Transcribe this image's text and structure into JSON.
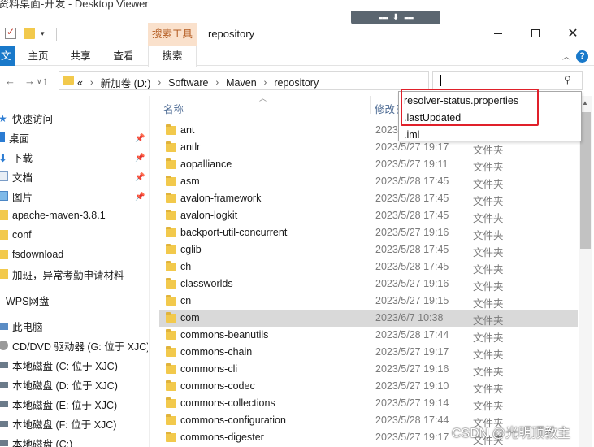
{
  "window": {
    "behind_title": "资料桌面-开发 - Desktop Viewer",
    "title": "repository",
    "context_tab": "搜索工具"
  },
  "remote_bar": {
    "dots_left": "▪▪▪▪▪",
    "arrow": "⬇",
    "dots_right": "▪▪▪▪▪"
  },
  "ribbon": {
    "file": "文件",
    "tabs": [
      "主页",
      "共享",
      "查看"
    ],
    "search_tab": "搜索",
    "help": "?"
  },
  "address": {
    "overflow": "«",
    "crumbs": [
      "新加卷 (D:)",
      "Software",
      "Maven",
      "repository"
    ]
  },
  "search": {
    "value": ""
  },
  "autocomplete": [
    "resolver-status.properties",
    ".lastUpdated",
    ".iml"
  ],
  "sidebar": {
    "quick_access": "快速访问",
    "items": [
      {
        "label": "桌面",
        "icon": "desktop-icon",
        "pinned": true
      },
      {
        "label": "下载",
        "icon": "download-icon",
        "pinned": true
      },
      {
        "label": "文档",
        "icon": "document-icon",
        "pinned": true
      },
      {
        "label": "图片",
        "icon": "picture-icon",
        "pinned": true
      },
      {
        "label": "apache-maven-3.8.1",
        "icon": "folder-icon",
        "pinned": false
      },
      {
        "label": "conf",
        "icon": "folder-icon",
        "pinned": false
      },
      {
        "label": "fsdownload",
        "icon": "folder-icon",
        "pinned": false
      },
      {
        "label": "加班，异常考勤申请材料",
        "icon": "folder-icon",
        "pinned": false
      }
    ],
    "wps": "WPS网盘",
    "this_pc": "此电脑",
    "drives": [
      {
        "label": "CD/DVD 驱动器 (G: 位于 XJC)",
        "icon": "dvd-icon"
      },
      {
        "label": "本地磁盘 (C: 位于 XJC)",
        "icon": "drive-icon"
      },
      {
        "label": "本地磁盘 (D: 位于 XJC)",
        "icon": "drive-icon"
      },
      {
        "label": "本地磁盘 (E: 位于 XJC)",
        "icon": "drive-icon"
      },
      {
        "label": "本地磁盘 (F: 位于 XJC)",
        "icon": "drive-icon"
      },
      {
        "label": "本地磁盘 (C:)",
        "icon": "drive-icon"
      }
    ]
  },
  "columns": {
    "name": "名称",
    "modified": "修改日"
  },
  "files": [
    {
      "name": "ant",
      "date": "2023",
      "type": "文件夹"
    },
    {
      "name": "antlr",
      "date": "2023/5/27 19:17",
      "type": "文件夹"
    },
    {
      "name": "aopalliance",
      "date": "2023/5/27 19:11",
      "type": "文件夹"
    },
    {
      "name": "asm",
      "date": "2023/5/28 17:45",
      "type": "文件夹"
    },
    {
      "name": "avalon-framework",
      "date": "2023/5/28 17:45",
      "type": "文件夹"
    },
    {
      "name": "avalon-logkit",
      "date": "2023/5/28 17:45",
      "type": "文件夹"
    },
    {
      "name": "backport-util-concurrent",
      "date": "2023/5/27 19:16",
      "type": "文件夹"
    },
    {
      "name": "cglib",
      "date": "2023/5/28 17:45",
      "type": "文件夹"
    },
    {
      "name": "ch",
      "date": "2023/5/28 17:45",
      "type": "文件夹"
    },
    {
      "name": "classworlds",
      "date": "2023/5/27 19:16",
      "type": "文件夹"
    },
    {
      "name": "cn",
      "date": "2023/5/27 19:15",
      "type": "文件夹"
    },
    {
      "name": "com",
      "date": "2023/6/7 10:38",
      "type": "文件夹",
      "highlighted": true
    },
    {
      "name": "commons-beanutils",
      "date": "2023/5/28 17:44",
      "type": "文件夹"
    },
    {
      "name": "commons-chain",
      "date": "2023/5/27 19:17",
      "type": "文件夹"
    },
    {
      "name": "commons-cli",
      "date": "2023/5/27 19:16",
      "type": "文件夹"
    },
    {
      "name": "commons-codec",
      "date": "2023/5/27 19:10",
      "type": "文件夹"
    },
    {
      "name": "commons-collections",
      "date": "2023/5/27 19:14",
      "type": "文件夹"
    },
    {
      "name": "commons-configuration",
      "date": "2023/5/28 17:44",
      "type": "文件夹"
    },
    {
      "name": "commons-digester",
      "date": "2023/5/27 19:17",
      "type": "文件夹"
    }
  ],
  "watermark": "CSDN @光明顶教主"
}
